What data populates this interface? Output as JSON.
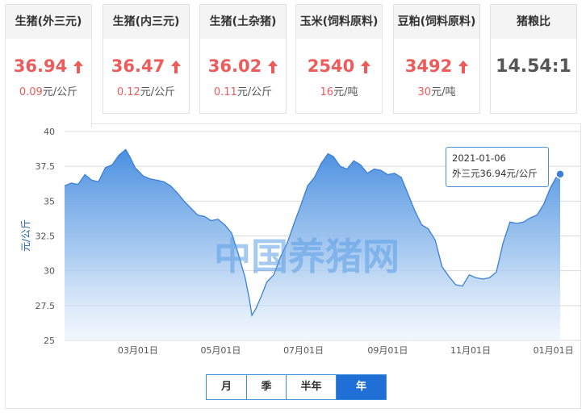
{
  "cards": [
    {
      "title": "生猪(外三元)",
      "value": "36.94",
      "change": "0.09",
      "unit": "元/公斤",
      "up": true
    },
    {
      "title": "生猪(内三元)",
      "value": "36.47",
      "change": "0.12",
      "unit": "元/公斤",
      "up": true
    },
    {
      "title": "生猪(土杂猪)",
      "value": "36.02",
      "change": "0.11",
      "unit": "元/公斤",
      "up": true
    },
    {
      "title": "玉米(饲料原料)",
      "value": "2540",
      "change": "16",
      "unit": "元/吨",
      "up": true
    },
    {
      "title": "豆粕(饲料原料)",
      "value": "3492",
      "change": "30",
      "unit": "元/吨",
      "up": true
    },
    {
      "title": "猪粮比",
      "value": "14.54:1",
      "change": "",
      "unit": "",
      "up": false
    }
  ],
  "colors": {
    "accent_red": "#ee5b5b",
    "line": "#3b7fd4",
    "area_top": "#4a8fe0",
    "button_active": "#1f6fd6"
  },
  "chart_data": {
    "type": "area",
    "ylabel": "元/公斤",
    "ylim": [
      25,
      40
    ],
    "yticks": [
      25,
      27.5,
      30,
      32.5,
      35,
      37.5,
      40
    ],
    "xlim": [
      "2020-01-07",
      "2021-01-06"
    ],
    "xticks": [
      {
        "date": "2020-03-01",
        "label": "03月01日"
      },
      {
        "date": "2020-05-01",
        "label": "05月01日"
      },
      {
        "date": "2020-07-01",
        "label": "07月01日"
      },
      {
        "date": "2020-09-01",
        "label": "09月01日"
      },
      {
        "date": "2020-11-01",
        "label": "11月01日"
      },
      {
        "date": "2021-01-01",
        "label": "01月01日"
      }
    ],
    "grid": true,
    "watermark": "中国养猪网",
    "series": [
      {
        "name": "外三元",
        "points": [
          [
            "2020-01-07",
            36.1
          ],
          [
            "2020-01-12",
            36.3
          ],
          [
            "2020-01-17",
            36.2
          ],
          [
            "2020-01-22",
            36.9
          ],
          [
            "2020-01-27",
            36.5
          ],
          [
            "2020-02-01",
            36.4
          ],
          [
            "2020-02-06",
            37.4
          ],
          [
            "2020-02-11",
            37.6
          ],
          [
            "2020-02-16",
            38.3
          ],
          [
            "2020-02-21",
            38.7
          ],
          [
            "2020-02-24",
            38.2
          ],
          [
            "2020-02-28",
            37.4
          ],
          [
            "2020-03-05",
            36.8
          ],
          [
            "2020-03-10",
            36.6
          ],
          [
            "2020-03-15",
            36.5
          ],
          [
            "2020-03-20",
            36.4
          ],
          [
            "2020-03-25",
            36.1
          ],
          [
            "2020-03-30",
            35.6
          ],
          [
            "2020-04-04",
            35.0
          ],
          [
            "2020-04-09",
            34.5
          ],
          [
            "2020-04-14",
            34.0
          ],
          [
            "2020-04-19",
            33.9
          ],
          [
            "2020-04-24",
            33.6
          ],
          [
            "2020-04-29",
            33.7
          ],
          [
            "2020-05-04",
            33.3
          ],
          [
            "2020-05-09",
            32.7
          ],
          [
            "2020-05-14",
            31.2
          ],
          [
            "2020-05-19",
            29.5
          ],
          [
            "2020-05-22",
            28.0
          ],
          [
            "2020-05-24",
            26.8
          ],
          [
            "2020-05-27",
            27.3
          ],
          [
            "2020-05-31",
            28.2
          ],
          [
            "2020-06-04",
            29.2
          ],
          [
            "2020-06-09",
            29.7
          ],
          [
            "2020-06-14",
            31.0
          ],
          [
            "2020-06-19",
            32.0
          ],
          [
            "2020-06-24",
            33.4
          ],
          [
            "2020-06-29",
            34.7
          ],
          [
            "2020-07-04",
            36.1
          ],
          [
            "2020-07-09",
            36.7
          ],
          [
            "2020-07-14",
            37.7
          ],
          [
            "2020-07-19",
            38.4
          ],
          [
            "2020-07-23",
            38.2
          ],
          [
            "2020-07-28",
            37.5
          ],
          [
            "2020-08-02",
            37.3
          ],
          [
            "2020-08-07",
            37.9
          ],
          [
            "2020-08-12",
            37.6
          ],
          [
            "2020-08-17",
            37.0
          ],
          [
            "2020-08-22",
            37.3
          ],
          [
            "2020-08-27",
            37.2
          ],
          [
            "2020-09-01",
            36.9
          ],
          [
            "2020-09-06",
            37.0
          ],
          [
            "2020-09-11",
            36.7
          ],
          [
            "2020-09-16",
            35.5
          ],
          [
            "2020-09-21",
            34.3
          ],
          [
            "2020-09-26",
            33.3
          ],
          [
            "2020-10-01",
            33.0
          ],
          [
            "2020-10-06",
            32.2
          ],
          [
            "2020-10-11",
            30.3
          ],
          [
            "2020-10-16",
            29.6
          ],
          [
            "2020-10-21",
            29.0
          ],
          [
            "2020-10-26",
            28.9
          ],
          [
            "2020-10-31",
            29.7
          ],
          [
            "2020-11-05",
            29.5
          ],
          [
            "2020-11-10",
            29.4
          ],
          [
            "2020-11-15",
            29.5
          ],
          [
            "2020-11-20",
            29.9
          ],
          [
            "2020-11-25",
            32.0
          ],
          [
            "2020-11-30",
            33.5
          ],
          [
            "2020-12-05",
            33.4
          ],
          [
            "2020-12-10",
            33.5
          ],
          [
            "2020-12-15",
            33.8
          ],
          [
            "2020-12-20",
            34.0
          ],
          [
            "2020-12-25",
            34.8
          ],
          [
            "2020-12-30",
            36.0
          ],
          [
            "2021-01-03",
            36.7
          ],
          [
            "2021-01-06",
            36.94
          ]
        ]
      }
    ],
    "tooltip": {
      "date": "2021-01-06",
      "text": "外三元36.94元/公斤"
    }
  },
  "range_buttons": [
    {
      "label": "月",
      "selected": false
    },
    {
      "label": "季",
      "selected": false
    },
    {
      "label": "半年",
      "selected": false
    },
    {
      "label": "年",
      "selected": true
    }
  ]
}
